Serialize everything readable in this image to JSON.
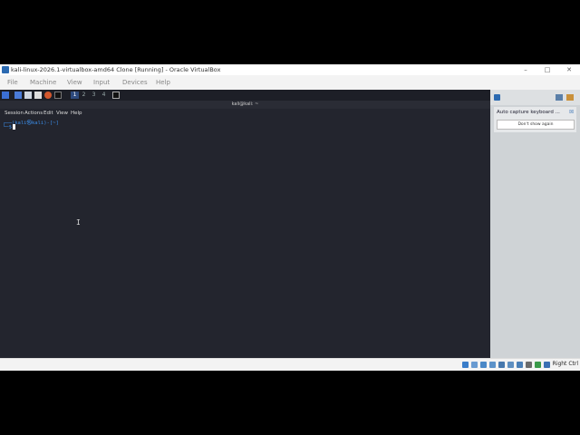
{
  "window": {
    "title": "kali-linux-2026.1-virtualbox-amd64 Clone [Running] - Oracle VirtualBox",
    "minimize": "–",
    "maximize": "□",
    "close": "✕"
  },
  "menu": {
    "file": "File",
    "machine": "Machine",
    "view": "View",
    "input": "Input",
    "devices": "Devices",
    "help": "Help"
  },
  "kali_panel": {
    "workspaces": [
      "1",
      "2",
      "3",
      "4"
    ],
    "active_workspace": "1"
  },
  "terminal": {
    "title": "kali@kali: ~",
    "menu": {
      "session": "Session",
      "actions": "Actions",
      "edit": "Edit",
      "view": "View",
      "help": "Help"
    },
    "prompt_line1": "┌──(kali㉿kali)-[~]",
    "prompt_line2": "└─$"
  },
  "notification": {
    "text": "Auto capture keyboard ...",
    "dismiss": "Don't show again",
    "close": "☒"
  },
  "statusbar": {
    "host_key": "Right Ctrl"
  },
  "colors": {
    "guest_bg": "#23252e",
    "prompt_blue": "#3b8eea",
    "vbox_bg": "#f3f3f3"
  }
}
